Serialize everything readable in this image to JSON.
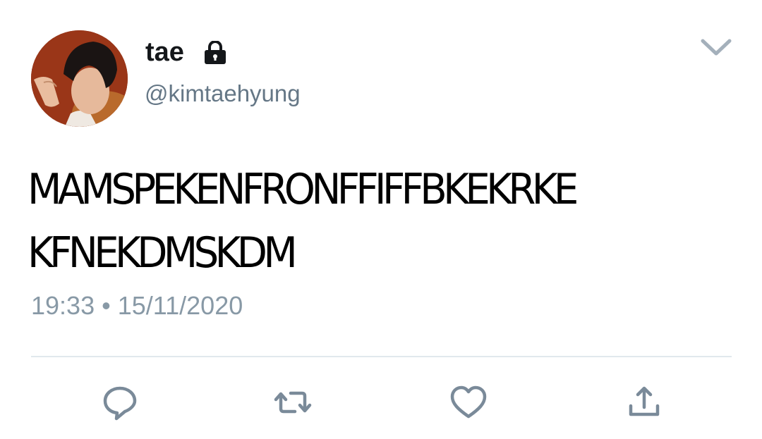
{
  "tweet": {
    "display_name": "tae",
    "handle": "@kimtaehyung",
    "text_lines": [
      "MAMSPEKENFRONFFIFFBKEKRKE",
      "KFNEKDMSKDM"
    ],
    "time": "19:33",
    "separator": "•",
    "date": "15/11/2020",
    "protected_icon": "lock-icon",
    "menu_icon": "chevron-down-icon"
  },
  "actions": [
    {
      "icon": "reply-icon"
    },
    {
      "icon": "retweet-icon"
    },
    {
      "icon": "like-icon"
    },
    {
      "icon": "share-icon"
    }
  ],
  "colors": {
    "text": "#14171a",
    "secondary": "#657786",
    "icon": "#7a8a99",
    "divider": "#e1e8ed"
  }
}
